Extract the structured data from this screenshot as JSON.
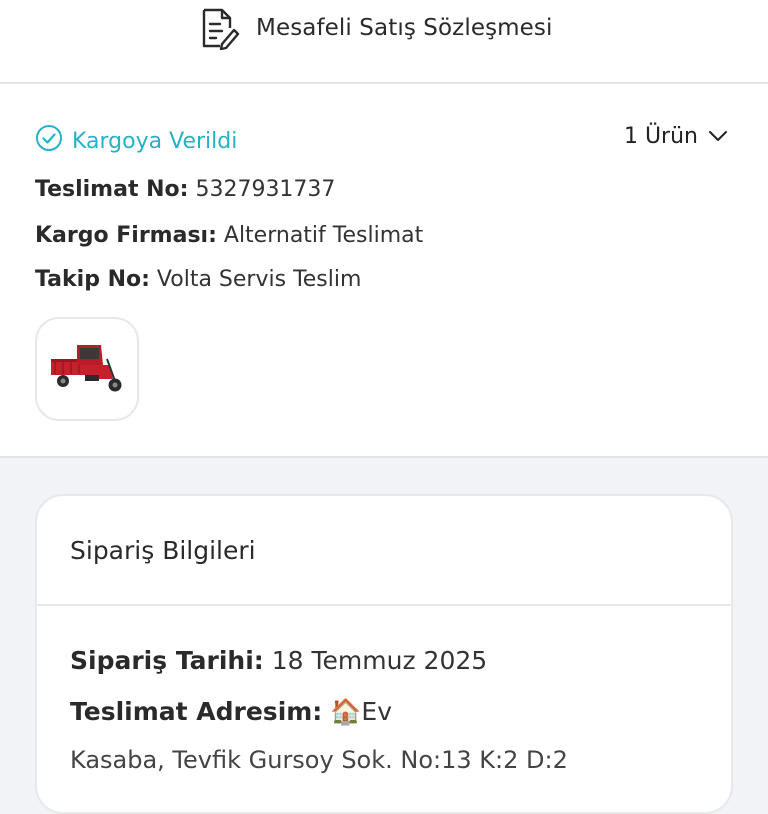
{
  "header": {
    "contract_label": "Mesafeli Satış Sözleşmesi",
    "contract_icon": "document-edit-icon"
  },
  "delivery": {
    "status": {
      "label": "Kargoya Verildi",
      "icon": "check-circle-icon",
      "color": "#27b1c7"
    },
    "product_count_label": "1 Ürün",
    "expand_icon": "chevron-down-icon",
    "delivery_no": {
      "label": "Teslimat No:",
      "value": "5327931737"
    },
    "cargo_company": {
      "label": "Kargo Firması:",
      "value": "Alternatif Teslimat"
    },
    "tracking_no": {
      "label": "Takip No:",
      "value": "Volta Servis Teslim"
    },
    "product_image": "red-electric-cargo-tricycle"
  },
  "order_info": {
    "title": "Sipariş Bilgileri",
    "order_date": {
      "label": "Sipariş Tarihi:",
      "value": "18 Temmuz 2025"
    },
    "delivery_address": {
      "label": "Teslimat Adresim:",
      "icon": "🏠",
      "value": "Ev"
    },
    "address_text": "Kasaba, Tevfik Gursoy Sok. No:13 K:2 D:2"
  }
}
